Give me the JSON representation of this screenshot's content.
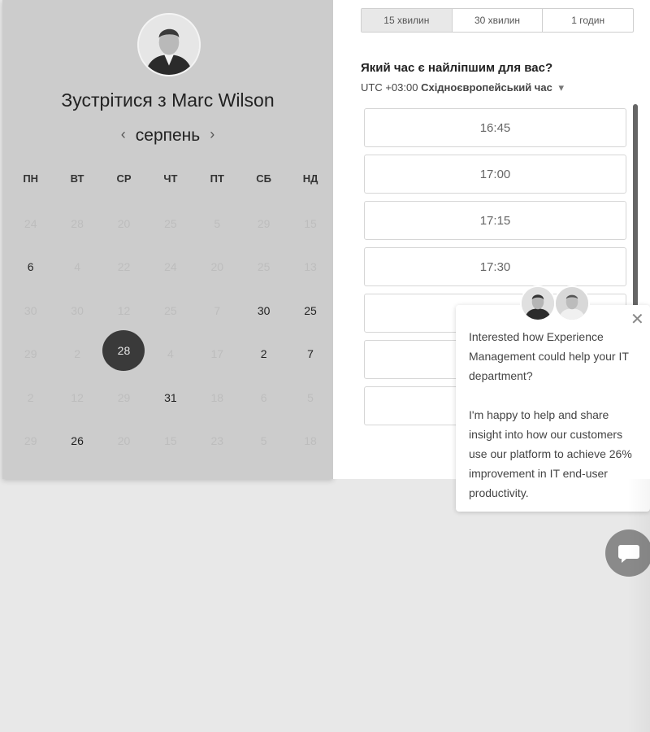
{
  "host": {
    "meet_prefix": "Зустрітися з ",
    "name": "Marc Wilson"
  },
  "calendar": {
    "month": "серпень",
    "weekdays": [
      "ПН",
      "ВТ",
      "СР",
      "ЧТ",
      "ПТ",
      "СБ",
      "НД"
    ],
    "weeks": [
      [
        {
          "d": "24",
          "a": false
        },
        {
          "d": "28",
          "a": false
        },
        {
          "d": "20",
          "a": false
        },
        {
          "d": "25",
          "a": false
        },
        {
          "d": "5",
          "a": false
        },
        {
          "d": "29",
          "a": false
        },
        {
          "d": "15",
          "a": false
        }
      ],
      [
        {
          "d": "6",
          "a": true
        },
        {
          "d": "4",
          "a": false
        },
        {
          "d": "22",
          "a": false
        },
        {
          "d": "24",
          "a": false
        },
        {
          "d": "20",
          "a": false
        },
        {
          "d": "25",
          "a": false
        },
        {
          "d": "13",
          "a": false
        }
      ],
      [
        {
          "d": "30",
          "a": false
        },
        {
          "d": "30",
          "a": false
        },
        {
          "d": "12",
          "a": false
        },
        {
          "d": "25",
          "a": false
        },
        {
          "d": "7",
          "a": false
        },
        {
          "d": "30",
          "a": true
        },
        {
          "d": "25",
          "a": true
        }
      ],
      [
        {
          "d": "29",
          "a": false
        },
        {
          "d": "2",
          "a": false
        },
        {
          "d": "28",
          "a": true,
          "sel": true
        },
        {
          "d": "4",
          "a": false
        },
        {
          "d": "17",
          "a": false
        },
        {
          "d": "2",
          "a": true
        },
        {
          "d": "7",
          "a": true
        }
      ],
      [
        {
          "d": "2",
          "a": false
        },
        {
          "d": "12",
          "a": false
        },
        {
          "d": "29",
          "a": false
        },
        {
          "d": "31",
          "a": true
        },
        {
          "d": "18",
          "a": false
        },
        {
          "d": "6",
          "a": false
        },
        {
          "d": "5",
          "a": false
        }
      ],
      [
        {
          "d": "29",
          "a": false
        },
        {
          "d": "26",
          "a": true
        },
        {
          "d": "20",
          "a": false
        },
        {
          "d": "15",
          "a": false
        },
        {
          "d": "23",
          "a": false
        },
        {
          "d": "5",
          "a": false
        },
        {
          "d": "18",
          "a": false
        }
      ]
    ]
  },
  "durations": [
    {
      "label": "15 хвилин",
      "active": true
    },
    {
      "label": "30 хвилин",
      "active": false
    },
    {
      "label": "1 годин",
      "active": false
    }
  ],
  "best_time_heading": "Який час є найліпшим для вас?",
  "timezone": {
    "offset": "UTC +03:00",
    "name": "Східноєвропейський час"
  },
  "time_slots": [
    "16:45",
    "17:00",
    "17:15",
    "17:30",
    "",
    "",
    ""
  ],
  "chat": {
    "paragraph1": "Interested how Experience Management could help your IT department?",
    "paragraph2": "I'm happy to help and share insight into how our customers use our platform to achieve 26% improvement in IT end-user productivity."
  },
  "icons": {
    "prev": "chevron-left-icon",
    "next": "chevron-right-icon",
    "close": "close-icon",
    "chat": "chat-bubble-icon",
    "tz_caret": "caret-down-icon"
  },
  "colors": {
    "left_panel_bg": "#cccccc",
    "selected_day": "#3a3a3a",
    "chat_fab": "#8a8a8a"
  }
}
